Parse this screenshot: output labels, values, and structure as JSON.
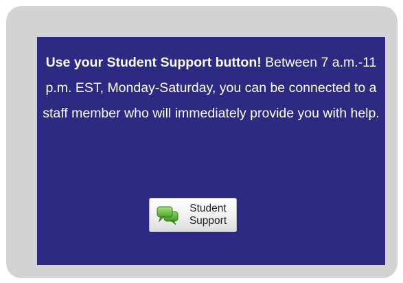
{
  "notice": {
    "lead": "Use your Student Support button!",
    "body": " Between 7 a.m.-11 p.m. EST, Monday-Saturday, you can be connected to a staff member who will immediately provide you with help."
  },
  "support_button": {
    "line1": "Student",
    "line2": "Support",
    "icon": "chat-bubbles-icon"
  },
  "colors": {
    "outer_card": "#d3d3d3",
    "panel_background": "#2e2a83",
    "panel_text": "#ffffff",
    "icon_green": "#5cb335"
  }
}
